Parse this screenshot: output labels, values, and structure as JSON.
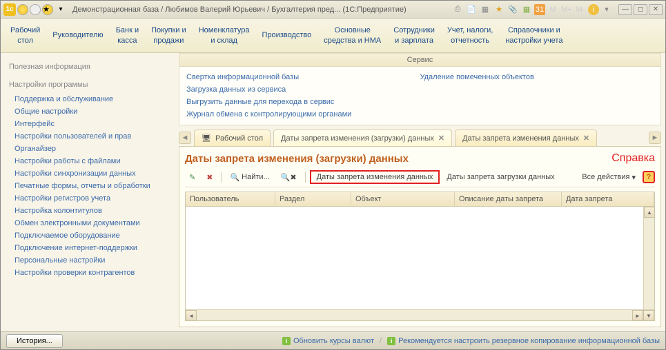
{
  "titlebar": {
    "title": "Демонстрационная база / Любимов Валерий Юрьевич / Бухгалтерия пред... (1С:Предприятие)"
  },
  "main_menu": [
    {
      "l1": "Рабочий",
      "l2": "стол"
    },
    {
      "l1": "Руководителю",
      "l2": ""
    },
    {
      "l1": "Банк и",
      "l2": "касса"
    },
    {
      "l1": "Покупки и",
      "l2": "продажи"
    },
    {
      "l1": "Номенклатура",
      "l2": "и склад"
    },
    {
      "l1": "Производство",
      "l2": ""
    },
    {
      "l1": "Основные",
      "l2": "средства и НМА"
    },
    {
      "l1": "Сотрудники",
      "l2": "и зарплата"
    },
    {
      "l1": "Учет, налоги,",
      "l2": "отчетность"
    },
    {
      "l1": "Справочники и",
      "l2": "настройки учета"
    }
  ],
  "sidebar": {
    "section1_title": "Полезная информация",
    "section2_title": "Настройки программы",
    "links": [
      "Поддержка и обслуживание",
      "Общие настройки",
      "Интерфейс",
      "Настройки пользователей и прав",
      "Органайзер",
      "Настройки работы с файлами",
      "Настройки синхронизации данных",
      "Печатные формы, отчеты и обработки",
      "Настройки регистров учета",
      "Настройка колонтитулов",
      "Обмен электронными документами",
      "Подключаемое оборудование",
      "Подключение интернет-поддержки",
      "Персональные настройки",
      "Настройки проверки контрагентов"
    ]
  },
  "service": {
    "header": "Сервис",
    "col1": [
      "Свертка информационной базы",
      "Загрузка данных из сервиса",
      "Выгрузить данные для перехода в сервис",
      "Журнал обмена с контролирующими органами"
    ],
    "col2": [
      "Удаление помеченных объектов"
    ]
  },
  "tabs": {
    "t1": "Рабочий стол",
    "t2": "Даты запрета изменения (загрузки) данных",
    "t3": "Даты запрета изменения данных"
  },
  "form": {
    "title": "Даты запрета изменения (загрузки) данных",
    "help_label": "Справка",
    "toolbar": {
      "find": "Найти...",
      "btn_highlighted": "Даты запрета изменения данных",
      "btn2": "Даты запрета загрузки данных",
      "all_actions": "Все действия"
    },
    "columns": {
      "c1": "Пользователь",
      "c2": "Раздел",
      "c3": "Объект",
      "c4": "Описание даты запрета",
      "c5": "Дата запрета"
    }
  },
  "statusbar": {
    "history": "История...",
    "link1": "Обновить курсы валют",
    "link2": "Рекомендуется настроить резервное копирование информационной базы"
  }
}
